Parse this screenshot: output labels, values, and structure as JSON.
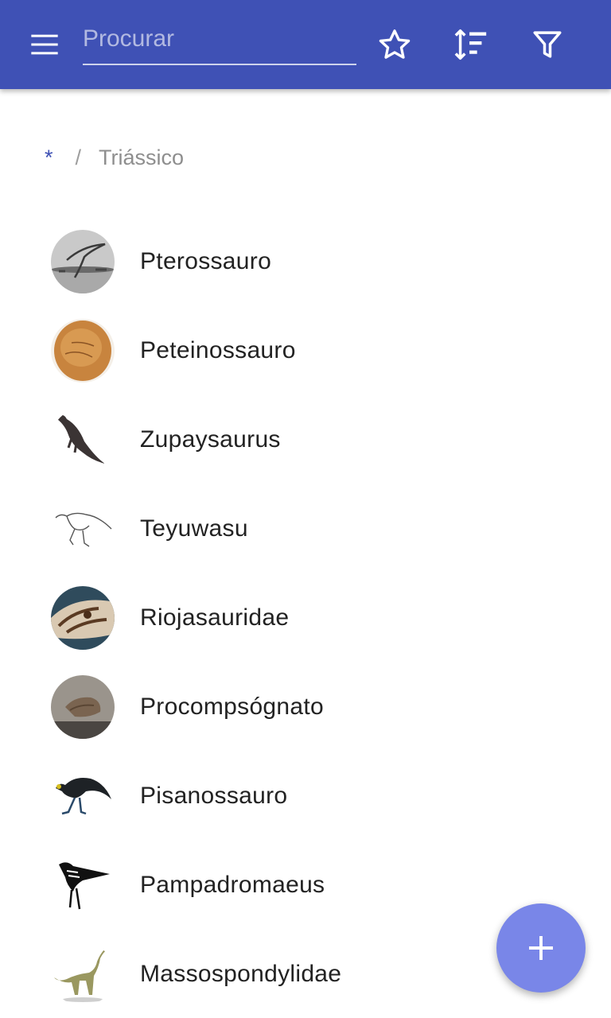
{
  "appbar": {
    "background": "#3f51b5",
    "menu_icon": "menu-icon",
    "search": {
      "placeholder": "Procurar",
      "value": ""
    },
    "actions": [
      "star-icon",
      "sort-icon",
      "filter-icon"
    ]
  },
  "breadcrumb": {
    "root": "*",
    "separator": "/",
    "current": "Triássico"
  },
  "items": [
    {
      "label": "Pterossauro"
    },
    {
      "label": "Peteinossauro"
    },
    {
      "label": "Zupaysaurus"
    },
    {
      "label": "Teyuwasu"
    },
    {
      "label": "Riojasauridae"
    },
    {
      "label": "Procompsógnato"
    },
    {
      "label": "Pisanossauro"
    },
    {
      "label": "Pampadromaeus"
    },
    {
      "label": "Massospondylidae"
    }
  ],
  "fab": {
    "icon": "plus-icon",
    "color": "#7986e8"
  }
}
